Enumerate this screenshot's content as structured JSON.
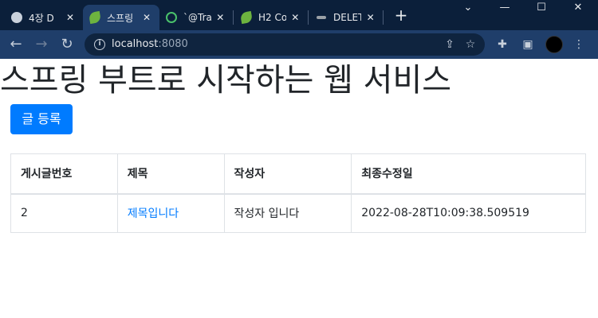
{
  "browser": {
    "tabs": [
      {
        "title": "4장 D",
        "icon": "globe-icon",
        "active": false
      },
      {
        "title": "스프링",
        "icon": "spring-leaf-icon",
        "active": true
      },
      {
        "title": "`@Tra",
        "icon": "q-circle-icon",
        "active": false
      },
      {
        "title": "H2 Co",
        "icon": "spring-leaf-icon",
        "active": false
      },
      {
        "title": "DELET",
        "icon": "dots-icon",
        "active": false
      }
    ],
    "close_glyph": "✕",
    "new_tab_glyph": "+",
    "url_host": "localhost",
    "url_port": ":8080"
  },
  "page": {
    "title": "스프링 부트로 시작하는 웹 서비스",
    "register_button": "글 등록"
  },
  "table": {
    "headers": [
      "게시글번호",
      "제목",
      "작성자",
      "최종수정일"
    ],
    "rows": [
      {
        "id": "2",
        "title": "제목입니다",
        "author": "작성자 입니다",
        "modified": "2022-08-28T10:09:38.509519"
      }
    ]
  },
  "colors": {
    "accent": "#007bff",
    "tabbar": "#0b1f3a",
    "toolbar": "#1f3e6a"
  }
}
